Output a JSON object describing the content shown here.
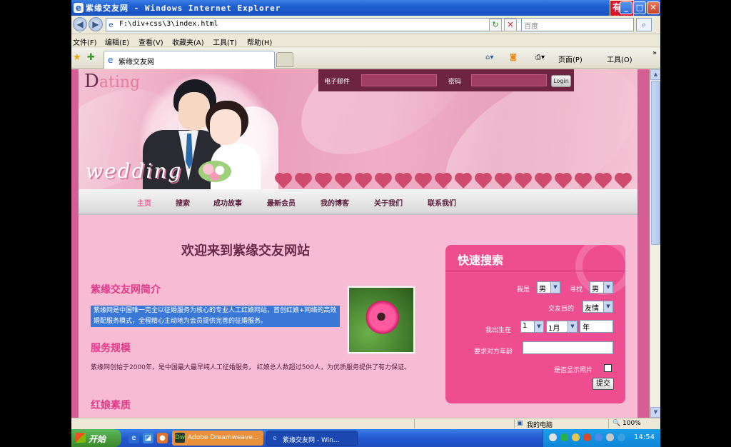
{
  "window": {
    "title": "紫缘交友网 - Windows Internet Explorer",
    "badge_text": "有陈软件",
    "minimize": "_",
    "maximize": "□",
    "close": "✕"
  },
  "addressbar": {
    "url": "F:\\div+css\\3\\index.html",
    "search_placeholder": "百度"
  },
  "menubar": [
    "文件(F)",
    "编辑(E)",
    "查看(V)",
    "收藏夹(A)",
    "工具(T)",
    "帮助(H)"
  ],
  "tabbar": {
    "tab_label": "紫缘交友网",
    "page_menu": "页面(P)",
    "tools_menu": "工具(O)",
    "more": "»"
  },
  "page": {
    "logo_first": "D",
    "logo_rest": "ating",
    "banner_text": "wedding",
    "login": {
      "email_label": "电子邮件",
      "password_label": "密码",
      "button": "Login"
    },
    "nav": [
      {
        "label": "主页",
        "active": true
      },
      {
        "label": "搜索",
        "active": false
      },
      {
        "label": "成功故事",
        "active": false
      },
      {
        "label": "最新会员",
        "active": false
      },
      {
        "label": "我的博客",
        "active": false
      },
      {
        "label": "关于我们",
        "active": false
      },
      {
        "label": "联系我们",
        "active": false
      }
    ],
    "welcome": "欢迎来到紫缘交友网站",
    "sections": {
      "intro_title": "紫缘交友网简介",
      "intro_text": "紫缘网是中国唯一完全以征婚服务为核心的专业人工红娘网站，首创红娘+网络的高效婚配服务模式，全程精心主动地为会员提供完善的征婚服务。",
      "scale_title": "服务规模",
      "scale_text": "紫缘网创始于2000年，是中国最大最早纯人工征婚服务， 红娘总人数超过500人，为优质服务提供了有力保证。",
      "matchmaker_title": "红娘素质"
    },
    "quick_search": {
      "title": "快速搜索",
      "i_am_label": "我是",
      "i_am_value": "男",
      "seek_label": "寻找",
      "seek_value": "男",
      "purpose_label": "交友目的",
      "purpose_value": "友情",
      "birth_label": "我出生在",
      "birth_day": "1",
      "birth_month": "1月",
      "birth_year": "年",
      "age_label": "要求对方年龄",
      "age_value": "",
      "photo_label": "是否显示照片",
      "submit": "提交"
    }
  },
  "statusbar": {
    "zone": "我的电脑",
    "zoom": "100%"
  },
  "taskbar": {
    "start": "开始",
    "items": [
      "Adobe Dreamweave...",
      "紫缘交友网 - Win..."
    ],
    "clock": "14:54"
  },
  "colors": {
    "accent": "#ee4d8f",
    "title_pink": "#e23a8a",
    "nav_active": "#e85a92"
  }
}
